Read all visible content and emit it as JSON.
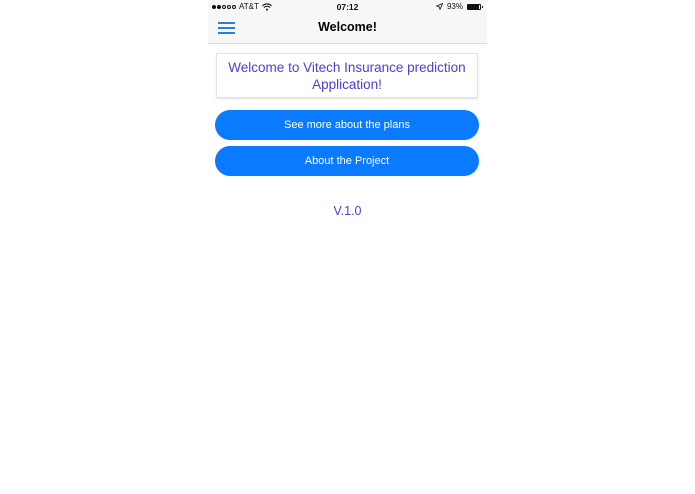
{
  "status_bar": {
    "carrier": "AT&T",
    "signal_bars_filled": 2,
    "signal_bars_total": 5,
    "time": "07:12",
    "battery_text": "93%",
    "battery_level": 0.93
  },
  "nav": {
    "title": "Welcome!",
    "menu_icon": "hamburger-icon",
    "accent_color": "#2a7fd4"
  },
  "main": {
    "welcome_text": "Welcome to Vitech Insurance prediction Application!",
    "buttons": [
      {
        "label": "See more about the plans"
      },
      {
        "label": "About the Project"
      }
    ],
    "version": "V.1.0",
    "button_color": "#0a7aff",
    "text_color": "#4a3fd6"
  }
}
